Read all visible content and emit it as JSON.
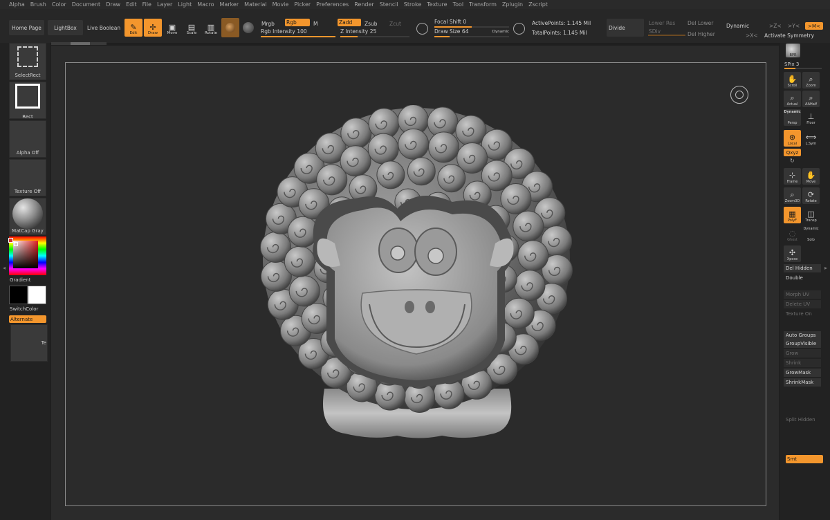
{
  "menu": [
    "Alpha",
    "Brush",
    "Color",
    "Document",
    "Draw",
    "Edit",
    "File",
    "Layer",
    "Light",
    "Macro",
    "Marker",
    "Material",
    "Movie",
    "Picker",
    "Preferences",
    "Render",
    "Stencil",
    "Stroke",
    "Texture",
    "Tool",
    "Transform",
    "Zplugin",
    "Zscript"
  ],
  "toolbar": {
    "home_page": "Home Page",
    "lightbox": "LightBox",
    "live_boolean": "Live Boolean",
    "edit": "Edit",
    "draw": "Draw",
    "move": "Move",
    "scale": "Scale",
    "rotate": "Rotate",
    "mrgb": "Mrgb",
    "rgb": "Rgb",
    "m": "M",
    "rgb_intensity_label": "Rgb Intensity",
    "rgb_intensity_value": "100",
    "zadd": "Zadd",
    "zsub": "Zsub",
    "zcut": "Zcut",
    "z_intensity_label": "Z Intensity",
    "z_intensity_value": "25",
    "focal_shift_label": "Focal Shift",
    "focal_shift_value": "0",
    "draw_size_label": "Draw Size",
    "draw_size_value": "64",
    "dynamic_small": "Dynamic",
    "active_points_label": "ActivePoints:",
    "active_points_value": "1.145 Mil",
    "total_points_label": "TotalPoints:",
    "total_points_value": "1.145 Mil",
    "divide": "Divide",
    "lower_res": "Lower Res",
    "sdiv": "SDiv",
    "del_lower": "Del Lower",
    "del_higher": "Del Higher",
    "dynamic": "Dynamic",
    "sym_z": ">Z<",
    "sym_y": ">Y<",
    "sym_m": ">M<",
    "sym_x": ">X<",
    "activate_symmetry": "Activate Symmetry",
    "rgb_intensity_fill": 1.0,
    "z_intensity_fill": 0.25,
    "draw_size_fill": 0.2
  },
  "left_shelf": {
    "select_rect": "SelectRect",
    "rect": "Rect",
    "alpha_off": "Alpha Off",
    "texture_off": "Texture Off",
    "matcap": "MatCap Gray",
    "gradient": "Gradient",
    "switch_color": "SwitchColor",
    "alternate": "Alternate",
    "te": "Te"
  },
  "right_shelf": {
    "bpr": "BPR",
    "spix": "SPix 3",
    "scroll": "Scroll",
    "zoom": "Zoom",
    "actual": "Actual",
    "aahalf": "AAHalf",
    "dynamic": "Dynamic",
    "persp": "Persp",
    "floor": "Floor",
    "local": "Local",
    "lsym": "L.Sym",
    "xyz": "Qxyz",
    "frame": "Frame",
    "move": "Move",
    "zoom3d": "Zoom3D",
    "rotate": "Rotate",
    "polyf": "PolyF",
    "transp": "Transp",
    "dynamic2": "Dynamic",
    "ghost": "Ghost",
    "solo": "Solo",
    "xpose": "Xpose",
    "del_hidden": "Del Hidden",
    "double": "Double",
    "morph_uv": "Morph UV",
    "delete_uv": "Delete UV",
    "texture_on": "Texture On",
    "auto_groups": "Auto Groups",
    "group_visible": "GroupVisible",
    "grow": "Grow",
    "shrink": "Shrink",
    "grow_mask": "GrowMask",
    "shrink_mask": "ShrinkMask",
    "split_hidden": "Split Hidden",
    "smt": "Smt"
  },
  "colors": {
    "accent": "#f3962d",
    "background": "#1f1f1f",
    "canvas": "#2e2e2e"
  }
}
